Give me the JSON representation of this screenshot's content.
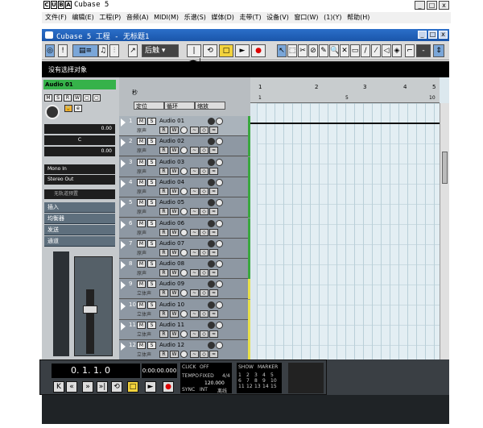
{
  "outer_window": {
    "title": "Cubase 5",
    "logo": [
      "C",
      "U",
      "B",
      "A"
    ],
    "buttons": [
      "_",
      "□",
      "x"
    ]
  },
  "menu": [
    "文件(F)",
    "编辑(E)",
    "工程(P)",
    "音频(A)",
    "MIDI(M)",
    "乐谱(S)",
    "媒体(D)",
    "走带(T)",
    "设备(V)",
    "窗口(W)",
    "(1)(Y)",
    "帮助(H)"
  ],
  "project_window": {
    "title": "Cubase 5 工程 - 无标题1",
    "buttons": [
      "_",
      "□",
      "x"
    ]
  },
  "toolbar": {
    "automation_mode": "后触",
    "snap_value": "-"
  },
  "info_line": "没有选择对象",
  "inspector": {
    "track_name": "Audio 01",
    "volume": "0.00",
    "pan": "C",
    "send": "0.00",
    "input": "Mono In",
    "output": "Stereo Out",
    "chord": "无轨道预置",
    "sections": [
      "插入",
      "均衡器",
      "发送",
      "通道"
    ]
  },
  "tracklist_header": {
    "label1": "秒",
    "mode1": "定位",
    "mode2": "循环",
    "mode3": "缩放"
  },
  "tracks": [
    {
      "num": "1",
      "name": "Audio 01",
      "sub": "原声",
      "color": "#3aa83f"
    },
    {
      "num": "2",
      "name": "Audio 02",
      "sub": "原声",
      "color": "#3aa83f"
    },
    {
      "num": "3",
      "name": "Audio 03",
      "sub": "原声",
      "color": "#3aa83f"
    },
    {
      "num": "4",
      "name": "Audio 04",
      "sub": "原声",
      "color": "#3aa83f"
    },
    {
      "num": "5",
      "name": "Audio 05",
      "sub": "原声",
      "color": "#3aa83f"
    },
    {
      "num": "6",
      "name": "Audio 06",
      "sub": "原声",
      "color": "#3aa83f"
    },
    {
      "num": "7",
      "name": "Audio 07",
      "sub": "原声",
      "color": "#3aa83f"
    },
    {
      "num": "8",
      "name": "Audio 08",
      "sub": "原声",
      "color": "#3aa83f"
    },
    {
      "num": "9",
      "name": "Audio 09",
      "sub": "立体声",
      "color": "#e8e04a"
    },
    {
      "num": "10",
      "name": "Audio 10",
      "sub": "立体声",
      "color": "#e8e04a"
    },
    {
      "num": "11",
      "name": "Audio 11",
      "sub": "立体声",
      "color": "#e8e04a"
    },
    {
      "num": "12",
      "name": "Audio 12",
      "sub": "立体声",
      "color": "#e8e04a"
    }
  ],
  "ruler": {
    "marks": [
      "1",
      "2",
      "3",
      "4",
      "5"
    ],
    "sub": [
      "1",
      "5",
      "10"
    ]
  },
  "transport": {
    "position": "0. 1. 1.  0",
    "time": "0:00:00.000",
    "click": "CLICK",
    "off": "OFF",
    "tempo_label": "TEMPO",
    "fixed": "FIXED",
    "sig": "4/4",
    "tempo": "120.000",
    "sync": "SYNC",
    "int": "INT",
    "show": "SHOW",
    "marker": "MARKER",
    "markers": [
      "1",
      "2",
      "3",
      "4",
      "5",
      "6",
      "7",
      "8",
      "9",
      "10",
      "11",
      "12",
      "13",
      "14",
      "15"
    ],
    "sync_mode": "离线"
  }
}
